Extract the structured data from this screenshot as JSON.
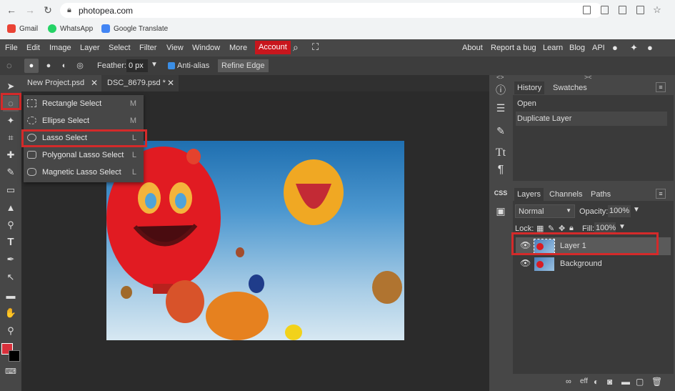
{
  "browser": {
    "url": "photopea.com",
    "bookmarks": [
      {
        "label": "Gmail",
        "color": "#ea4335"
      },
      {
        "label": "WhatsApp",
        "color": "#25d366"
      },
      {
        "label": "Google Translate",
        "color": "#4285f4"
      }
    ]
  },
  "menu": {
    "items": [
      "File",
      "Edit",
      "Image",
      "Layer",
      "Select",
      "Filter",
      "View",
      "Window",
      "More"
    ],
    "account": "Account",
    "right": [
      "About",
      "Report a bug",
      "Learn",
      "Blog",
      "API"
    ]
  },
  "options": {
    "feather_label": "Feather:",
    "feather_value": "0 px",
    "antialias_label": "Anti-alias",
    "refine_label": "Refine Edge"
  },
  "tabs": [
    {
      "label": "New Project.psd"
    },
    {
      "label": "DSC_8679.psd *"
    }
  ],
  "dropdown": [
    {
      "label": "Rectangle Select",
      "key": "M"
    },
    {
      "label": "Ellipse Select",
      "key": "M"
    },
    {
      "label": "Lasso Select",
      "key": "L"
    },
    {
      "label": "Polygonal Lasso Select",
      "key": "L"
    },
    {
      "label": "Magnetic Lasso Select",
      "key": "L"
    }
  ],
  "history": {
    "tabs": [
      "History",
      "Swatches"
    ],
    "items": [
      "Open",
      "Duplicate Layer"
    ]
  },
  "layers": {
    "tabs": [
      "Layers",
      "Channels",
      "Paths"
    ],
    "blend_mode": "Normal",
    "opacity_label": "Opacity:",
    "opacity_value": "100%",
    "lock_label": "Lock:",
    "fill_label": "Fill:",
    "fill_value": "100%",
    "items": [
      "Layer 1",
      "Background"
    ]
  },
  "strip": {
    "css": "CSS"
  },
  "colors": {
    "accent": "#c8161d",
    "foreground": "#d8303b",
    "background": "#000000"
  }
}
